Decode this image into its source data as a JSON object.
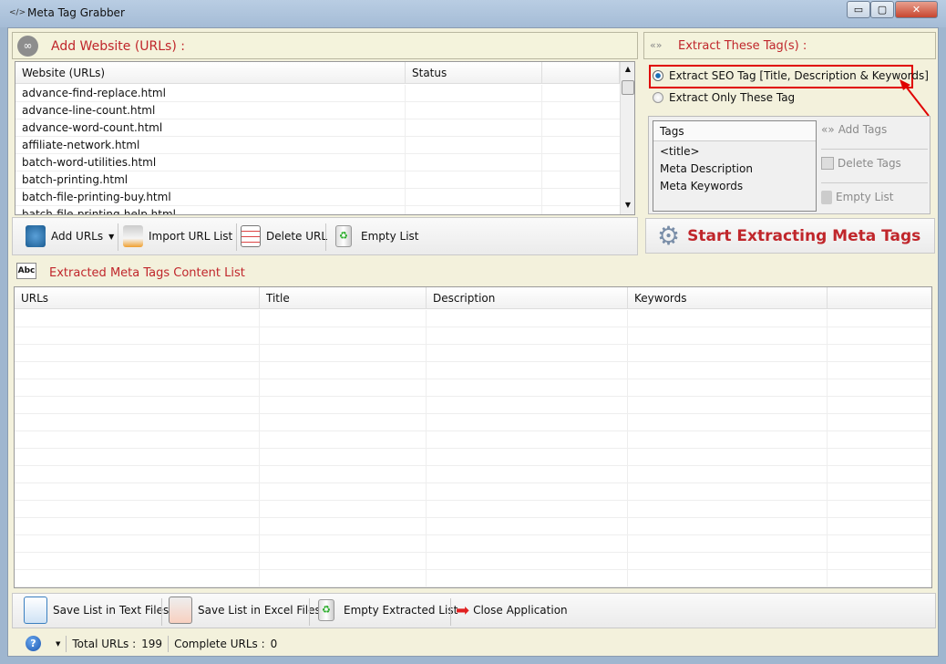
{
  "window": {
    "title": "Meta Tag Grabber",
    "minimize": "▭",
    "maximize": "▢",
    "close": "✕"
  },
  "add_website": {
    "heading": "Add Website (URLs) :",
    "columns": [
      "Website (URLs)",
      "Status",
      ""
    ],
    "rows": [
      "advance-find-replace.html",
      "advance-line-count.html",
      "advance-word-count.html",
      "affiliate-network.html",
      "batch-word-utilities.html",
      "batch-printing.html",
      "batch-file-printing-buy.html",
      "batch-file-printing-help.html"
    ],
    "toolbar": {
      "add_urls": "Add URLs",
      "import": "Import URL List",
      "delete": "Delete URL",
      "empty": "Empty List"
    }
  },
  "extract": {
    "heading": "Extract These Tag(s) :",
    "option_seo": "Extract SEO Tag [Title, Description & Keywords]",
    "option_only": "Extract Only These Tag",
    "selected": "seo",
    "tags_header": "Tags",
    "tags": [
      "<title>",
      "Meta Description",
      "Meta Keywords"
    ],
    "add_tags": "Add Tags",
    "delete_tags": "Delete Tags",
    "empty_list": "Empty List",
    "start": "Start Extracting Meta Tags"
  },
  "results": {
    "heading": "Extracted Meta Tags Content List",
    "columns": [
      "URLs",
      "Title",
      "Description",
      "Keywords"
    ]
  },
  "bottom_toolbar": {
    "save_text": "Save List in Text Files",
    "save_excel": "Save List in Excel Files",
    "empty_extracted": "Empty Extracted List",
    "close": "Close Application"
  },
  "status": {
    "total_label": "Total URLs :",
    "total": "199",
    "complete_label": "Complete URLs :",
    "complete": "0"
  },
  "colors": {
    "accent_red": "#c0262b",
    "highlight_box": "#e00000",
    "background": "#f3f1dc"
  }
}
